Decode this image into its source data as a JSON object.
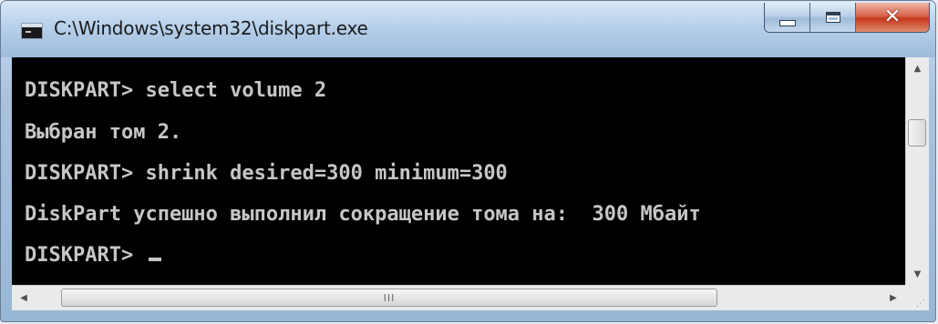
{
  "window": {
    "title": "C:\\Windows\\system32\\diskpart.exe",
    "icon": "console-window-icon",
    "controls": {
      "minimize_icon": "minimize-icon",
      "maximize_icon": "maximize-icon",
      "close_icon": "close-icon",
      "close_glyph": "✕"
    }
  },
  "console": {
    "lines": [
      "DISKPART> select volume 2",
      "Выбран том 2.",
      "DISKPART> shrink desired=300 minimum=300",
      "DiskPart успешно выполнил сокращение тома на:  300 Мбайт",
      "DISKPART> "
    ],
    "text_color": "#c6c6c6",
    "background_color": "#000000"
  },
  "scrollbars": {
    "up_arrow": "▲",
    "down_arrow": "▼",
    "left_arrow": "◀",
    "right_arrow": "▶",
    "h_thumb_grip": "III",
    "size_grip": "⋰"
  }
}
